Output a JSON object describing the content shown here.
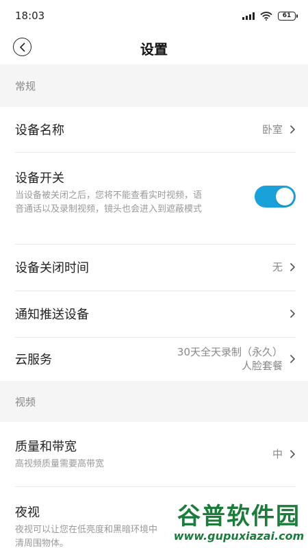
{
  "status_bar": {
    "time": "18:03",
    "battery": "61"
  },
  "header": {
    "title": "设置"
  },
  "sections": {
    "general": {
      "title": "常规",
      "device_name": {
        "label": "设备名称",
        "value": "卧室"
      },
      "device_switch": {
        "label": "设备开关",
        "desc_line1": "当设备被关闭之后，您将不能查看实时视频，语",
        "desc_line2": "音通话以及录制视频，镜头也会进入到遮蔽模式",
        "on": true
      },
      "off_time": {
        "label": "设备关闭时间",
        "value": "无"
      },
      "push_device": {
        "label": "通知推送设备"
      },
      "cloud": {
        "label": "云服务",
        "value_line1": "30天全天录制（永久）",
        "value_line2": "人脸套餐"
      }
    },
    "video": {
      "title": "视频",
      "quality": {
        "label": "质量和带宽",
        "value": "中",
        "desc": "高视频质量需要高带宽"
      },
      "night": {
        "label": "夜视",
        "desc_line1": "夜视可以让您在低亮度和黑暗环境中",
        "desc_line2": "清周围物体。"
      }
    }
  },
  "watermark": {
    "title": "谷普软件园",
    "url": "www.gupuxiazai.com"
  },
  "colors": {
    "accent": "#1ba1d9",
    "section_bg": "#f5f5f5",
    "watermark": "#1a7d3a"
  }
}
